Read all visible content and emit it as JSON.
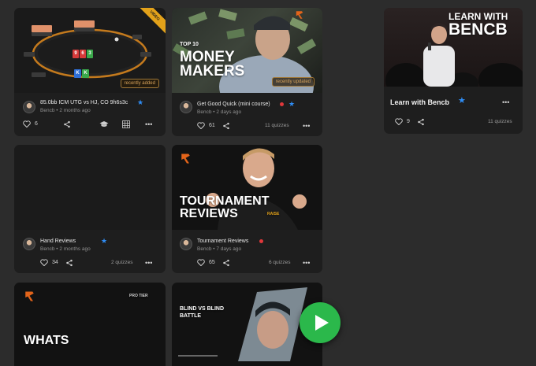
{
  "colors": {
    "background": "#2c2c2c",
    "card": "#1e1e1e",
    "accent_blue": "#2f8df5",
    "play_green": "#2bb84b",
    "recent_orange": "#d6a25b",
    "red_dot": "#e0383b"
  },
  "cards": [
    {
      "ribbon": "VIDEO",
      "badge": "recently added",
      "title": "85.0bb ICM UTG vs HJ, CO 9h6s3c",
      "sub": "Bencb • 2 months ago",
      "like_count": "6",
      "icons": [
        "heart-icon",
        "share-icon",
        "graduation-cap-icon",
        "grid-icon",
        "more-icon"
      ],
      "table_cards": [
        "9",
        "6",
        "3"
      ],
      "hole_cards": [
        "K",
        "K"
      ]
    },
    {
      "thumb_small": "TOP 10",
      "thumb_line1": "MONEY",
      "thumb_line2": "MAKERS",
      "badge": "recently updated",
      "title": "Get Good Quick (mini course)",
      "sub": "Bencb • 2 days ago",
      "like_count": "61",
      "quizzes": "11 quizzes"
    },
    {
      "thumb_line1": "LEARN WITH",
      "thumb_line2": "BENCB",
      "title": "Learn with Bencb",
      "like_count": "9",
      "quizzes": "11 quizzes"
    },
    {
      "title": "Hand Reviews",
      "sub": "Bencb • 2 months ago",
      "like_count": "34",
      "quizzes": "2 quizzes"
    },
    {
      "thumb_line1": "TOURNAMENT",
      "thumb_line2": "REVIEWS",
      "shirt_text": "RAISE",
      "title": "Tournament Reviews",
      "sub": "Bencb • 7 days ago",
      "like_count": "65",
      "quizzes": "6 quizzes"
    },
    {
      "tier": "PRO TIER",
      "thumb_line1": "WHATS"
    },
    {
      "thumb_line1": "BLIND VS BLIND",
      "thumb_line2": "BATTLE"
    }
  ],
  "more_label": "•••",
  "star_glyph": "★",
  "play_button": "play-icon"
}
